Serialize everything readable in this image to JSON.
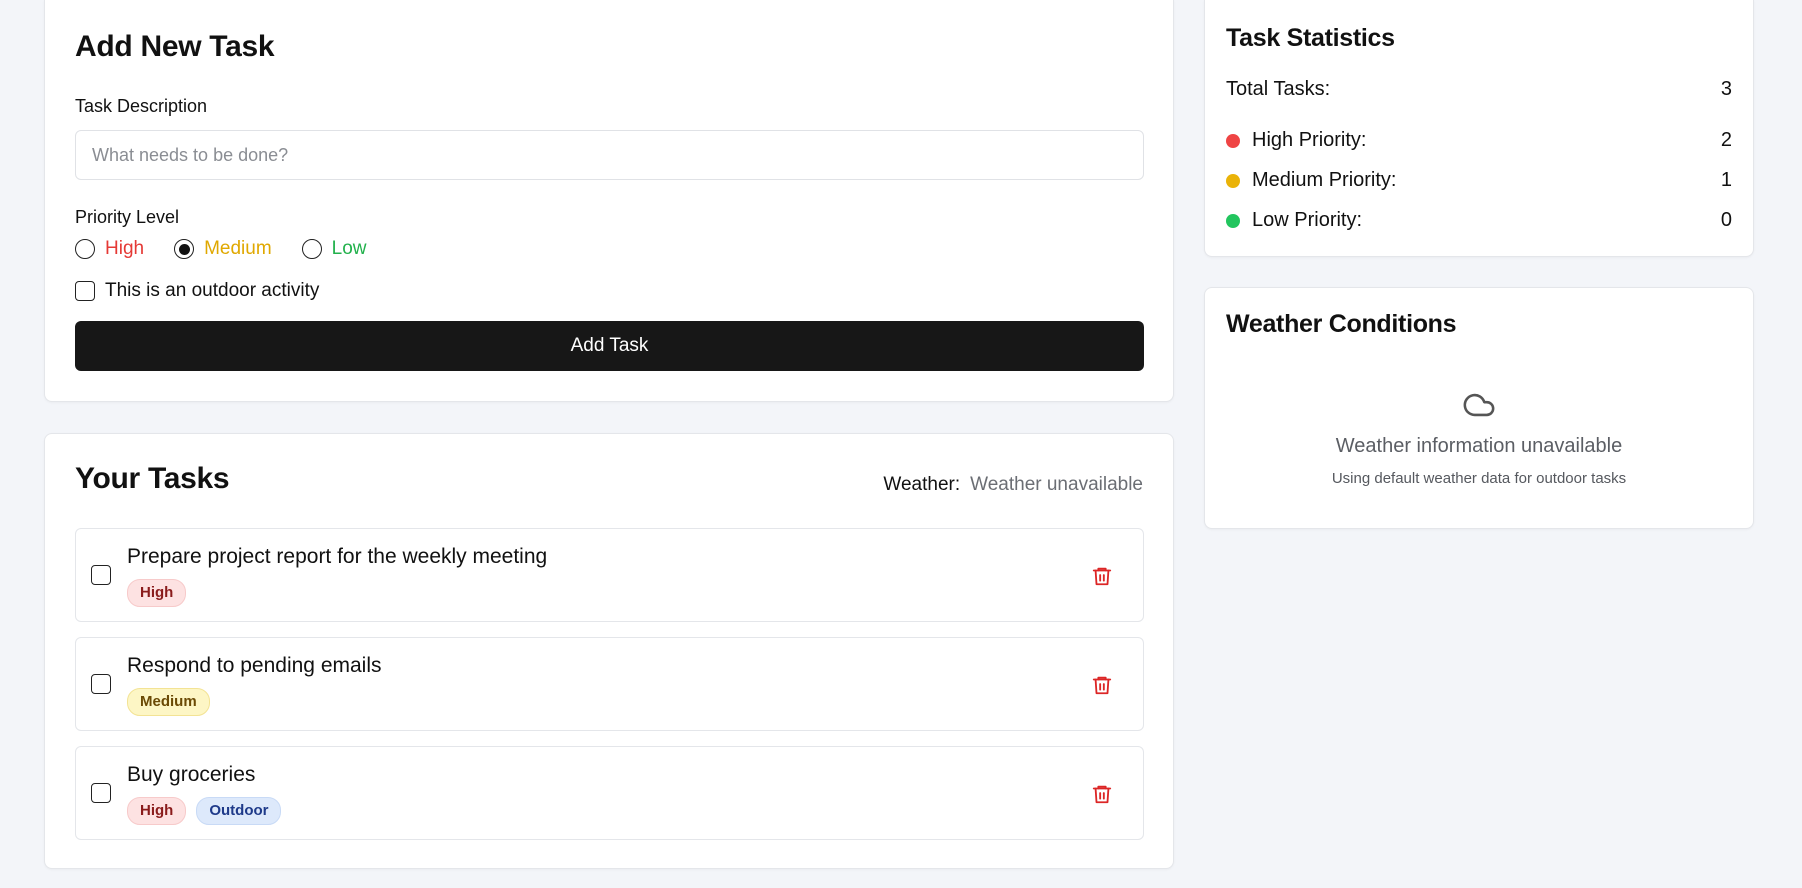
{
  "add_task": {
    "title": "Add New Task",
    "description_label": "Task Description",
    "description_placeholder": "What needs to be done?",
    "description_value": "",
    "priority_label": "Priority Level",
    "priority_options": [
      {
        "label": "High",
        "color": "#e53935",
        "selected": false
      },
      {
        "label": "Medium",
        "color": "#e0a800",
        "selected": true
      },
      {
        "label": "Low",
        "color": "#22b14c",
        "selected": false
      }
    ],
    "outdoor_label": "This is an outdoor activity",
    "outdoor_checked": false,
    "submit_label": "Add Task"
  },
  "tasks": {
    "title": "Your Tasks",
    "weather_key": "Weather:",
    "weather_value": "Weather unavailable",
    "items": [
      {
        "title": "Prepare project report for the weekly meeting",
        "badges": [
          {
            "label": "High",
            "kind": "high"
          }
        ],
        "completed": false
      },
      {
        "title": "Respond to pending emails",
        "badges": [
          {
            "label": "Medium",
            "kind": "medium"
          }
        ],
        "completed": false
      },
      {
        "title": "Buy groceries",
        "badges": [
          {
            "label": "High",
            "kind": "high"
          },
          {
            "label": "Outdoor",
            "kind": "outdoor"
          }
        ],
        "completed": false
      }
    ],
    "delete_icon": "trash-icon",
    "delete_color": "#dc2626"
  },
  "stats": {
    "title": "Task Statistics",
    "total_label": "Total Tasks:",
    "total_value": "3",
    "rows": [
      {
        "label": "High Priority:",
        "value": "2",
        "color": "#ef4444"
      },
      {
        "label": "Medium Priority:",
        "value": "1",
        "color": "#eab308"
      },
      {
        "label": "Low Priority:",
        "value": "0",
        "color": "#22c55e"
      }
    ]
  },
  "weather": {
    "title": "Weather Conditions",
    "icon": "cloud-icon",
    "message": "Weather information unavailable",
    "sub_message": "Using default weather data for outdoor tasks"
  }
}
